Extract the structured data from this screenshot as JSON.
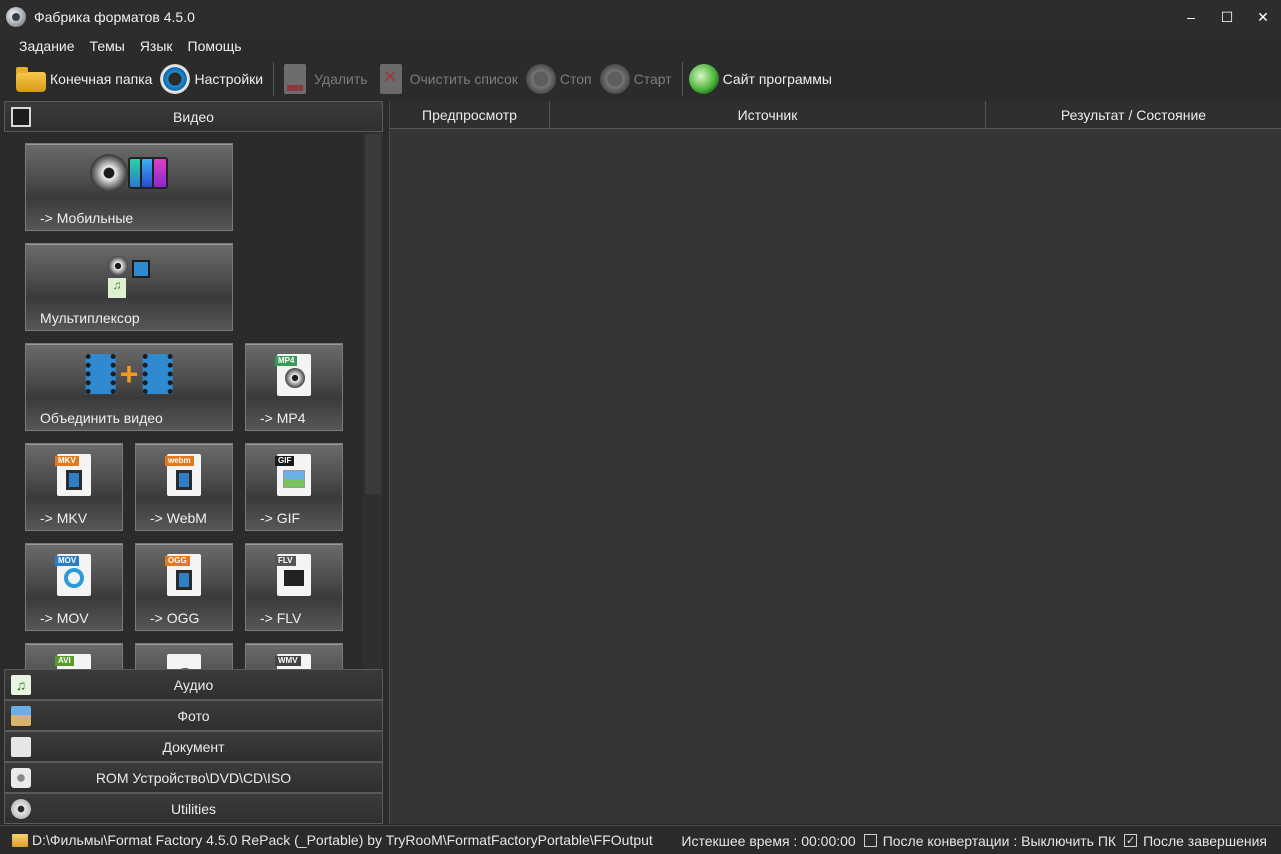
{
  "window": {
    "title": "Фабрика форматов 4.5.0",
    "controls": {
      "minimize": "–",
      "maximize": "☐",
      "close": "✕"
    }
  },
  "menu": [
    "Задание",
    "Темы",
    "Язык",
    "Помощь"
  ],
  "toolbar": {
    "output_folder": "Конечная папка",
    "settings": "Настройки",
    "delete": "Удалить",
    "clear_list": "Очистить список",
    "stop": "Стоп",
    "start": "Старт",
    "website": "Сайт программы"
  },
  "sidebar": {
    "video_header": "Видео",
    "tiles": [
      {
        "label": "-> Мобильные",
        "icon": "mobile-devices-icon"
      },
      {
        "label": "Мультиплексор",
        "icon": "muxer-icon"
      },
      {
        "label": "Объединить видео",
        "icon": "join-video-icon"
      },
      {
        "label": "-> MP4",
        "badge": "MP4",
        "badge_color": "#3a9a5a"
      },
      {
        "label": "-> MKV",
        "badge": "MKV",
        "badge_color": "#e07a1f"
      },
      {
        "label": "-> WebM",
        "badge": "webm",
        "badge_color": "#e07a1f"
      },
      {
        "label": "-> GIF",
        "badge": "GIF",
        "badge_color": "#1a1a1a"
      },
      {
        "label": "-> MOV",
        "badge": "MOV",
        "badge_color": "#2a7fc4"
      },
      {
        "label": "-> OGG",
        "badge": "OGG",
        "badge_color": "#e07a1f"
      },
      {
        "label": "-> FLV",
        "badge": "FLV",
        "badge_color": "#555555"
      },
      {
        "label": "",
        "badge": "AVI",
        "badge_color": "#5a9a2a"
      },
      {
        "label": "",
        "badge": "",
        "badge_color": "#3a9a5a"
      },
      {
        "label": "",
        "badge": "WMV",
        "badge_color": "#444444"
      }
    ],
    "categories": [
      "Аудио",
      "Фото",
      "Документ",
      "ROM Устройство\\DVD\\CD\\ISO",
      "Utilities"
    ]
  },
  "table": {
    "columns": [
      "Предпросмотр",
      "Источник",
      "Результат / Состояние"
    ]
  },
  "status": {
    "path": "D:\\Фильмы\\Format Factory 4.5.0 RePack (_Portable) by TryRooM\\FormatFactoryPortable\\FFOutput",
    "elapsed": "Истекшее время : 00:00:00",
    "after_convert": "После конвертации : Выключить ПК",
    "after_convert_checked": false,
    "after_finish": "После завершения",
    "after_finish_checked": true
  }
}
